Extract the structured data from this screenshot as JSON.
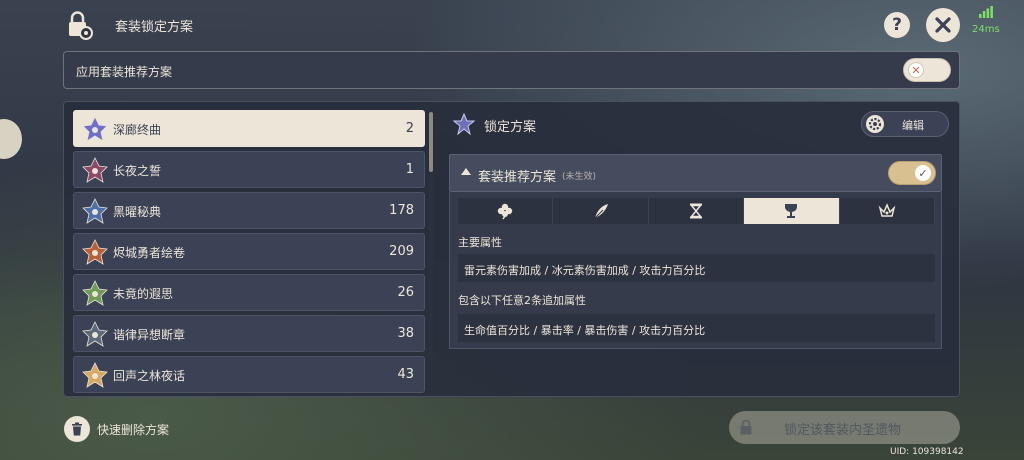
{
  "header": {
    "title": "套装锁定方案",
    "help_label": "?",
    "ping": "24ms"
  },
  "apply_row": {
    "label": "应用套装推荐方案",
    "toggle_on": false
  },
  "set_list": [
    {
      "name": "深廊终曲",
      "count": "2",
      "selected": true,
      "icon": "deep-gallery-icon"
    },
    {
      "name": "长夜之誓",
      "count": "1",
      "selected": false,
      "icon": "long-night-icon"
    },
    {
      "name": "黑曜秘典",
      "count": "178",
      "selected": false,
      "icon": "obsidian-codex-icon"
    },
    {
      "name": "烬城勇者绘卷",
      "count": "209",
      "selected": false,
      "icon": "scroll-hero-icon"
    },
    {
      "name": "未竟的遐思",
      "count": "26",
      "selected": false,
      "icon": "unfinished-reverie-icon"
    },
    {
      "name": "谐律异想断章",
      "count": "38",
      "selected": false,
      "icon": "harmonic-whimsy-icon"
    },
    {
      "name": "回声之林夜话",
      "count": "43",
      "selected": false,
      "icon": "echoing-woods-icon"
    }
  ],
  "lock_panel": {
    "title": "锁定方案",
    "edit_label": "编辑",
    "recommend": {
      "title": "套装推荐方案",
      "status": "(未生效)",
      "toggle_on": true
    },
    "slot_tabs": [
      {
        "icon": "flower-icon",
        "active": false
      },
      {
        "icon": "feather-icon",
        "active": false
      },
      {
        "icon": "hourglass-icon",
        "active": false
      },
      {
        "icon": "goblet-icon",
        "active": true
      },
      {
        "icon": "circlet-icon",
        "active": false
      }
    ],
    "main_stat_label": "主要属性",
    "main_stat_value": "雷元素伤害加成 / 冰元素伤害加成 / 攻击力百分比",
    "sub_stat_label": "包含以下任意2条追加属性",
    "sub_stat_value": "生命值百分比 / 暴击率 / 暴击伤害 / 攻击力百分比"
  },
  "footer": {
    "delete_label": "快速删除方案",
    "lock_set_label": "锁定该套装内圣遗物",
    "uid": "UID: 109398142"
  },
  "colors": {
    "cream": "#ece5d8",
    "panel": "#3b4255",
    "toggle_gold": "#d8c091",
    "ping_green": "#7ddf64"
  }
}
